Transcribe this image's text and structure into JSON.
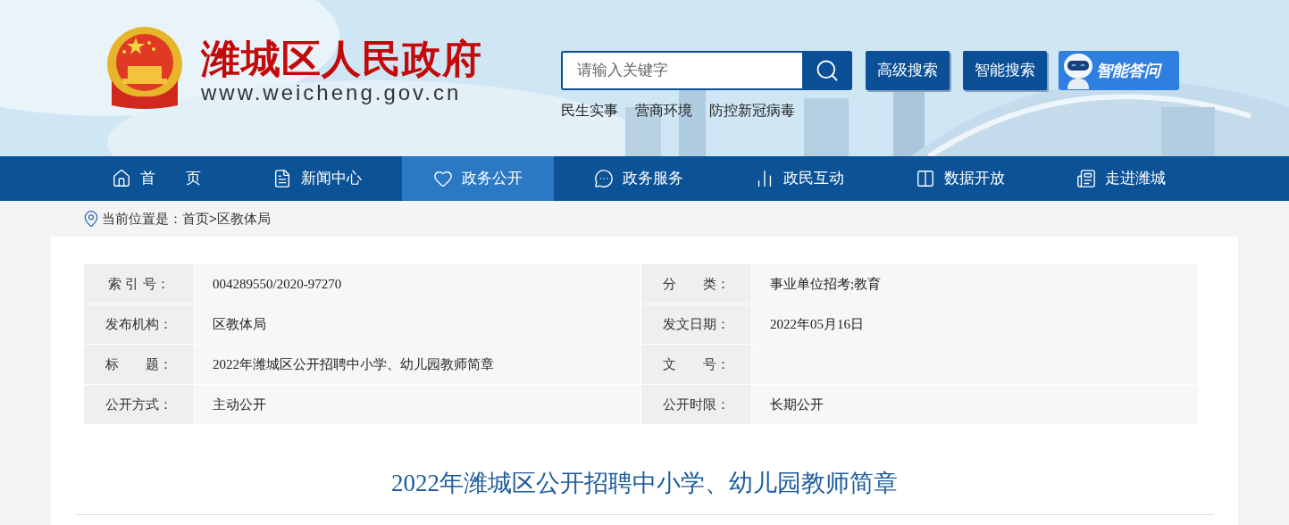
{
  "site": {
    "title": "潍城区人民政府",
    "url": "www.weicheng.gov.cn"
  },
  "search": {
    "placeholder": "请输入关键字",
    "buttons": [
      "高级搜索",
      "智能搜索"
    ],
    "assistant": "智能答问",
    "hot_links": [
      "民生实事",
      "营商环境",
      "防控新冠病毒"
    ]
  },
  "nav": [
    {
      "label": "首　　页",
      "kind": "home",
      "selected": false
    },
    {
      "label": "新闻中心",
      "kind": "news",
      "selected": false
    },
    {
      "label": "政务公开",
      "kind": "openness",
      "selected": true
    },
    {
      "label": "政务服务",
      "kind": "service",
      "selected": false
    },
    {
      "label": "政民互动",
      "kind": "interaction",
      "selected": false
    },
    {
      "label": "数据开放",
      "kind": "data",
      "selected": false
    },
    {
      "label": "走进潍城",
      "kind": "about",
      "selected": false
    }
  ],
  "breadcrumb": {
    "label": "当前位置是：",
    "items": [
      "首页",
      "区教体局"
    ],
    "separator": ">"
  },
  "info_table": [
    [
      {
        "label": "索 引 号：",
        "value": "004289550/2020-97270"
      },
      {
        "label": "分　　类：",
        "value": "事业单位招考;教育"
      }
    ],
    [
      {
        "label": "发布机构：",
        "value": "区教体局"
      },
      {
        "label": "发文日期：",
        "value": "2022年05月16日"
      }
    ],
    [
      {
        "label": "标　　题：",
        "value": "2022年潍城区公开招聘中小学、幼儿园教师简章"
      },
      {
        "label": "文　　号："
      }
    ],
    [
      {
        "label": "公开方式：",
        "value": "主动公开"
      },
      {
        "label": "公开时限：",
        "value": "长期公开"
      }
    ]
  ],
  "article": {
    "title": "2022年潍城区公开招聘中小学、幼儿园教师简章"
  }
}
